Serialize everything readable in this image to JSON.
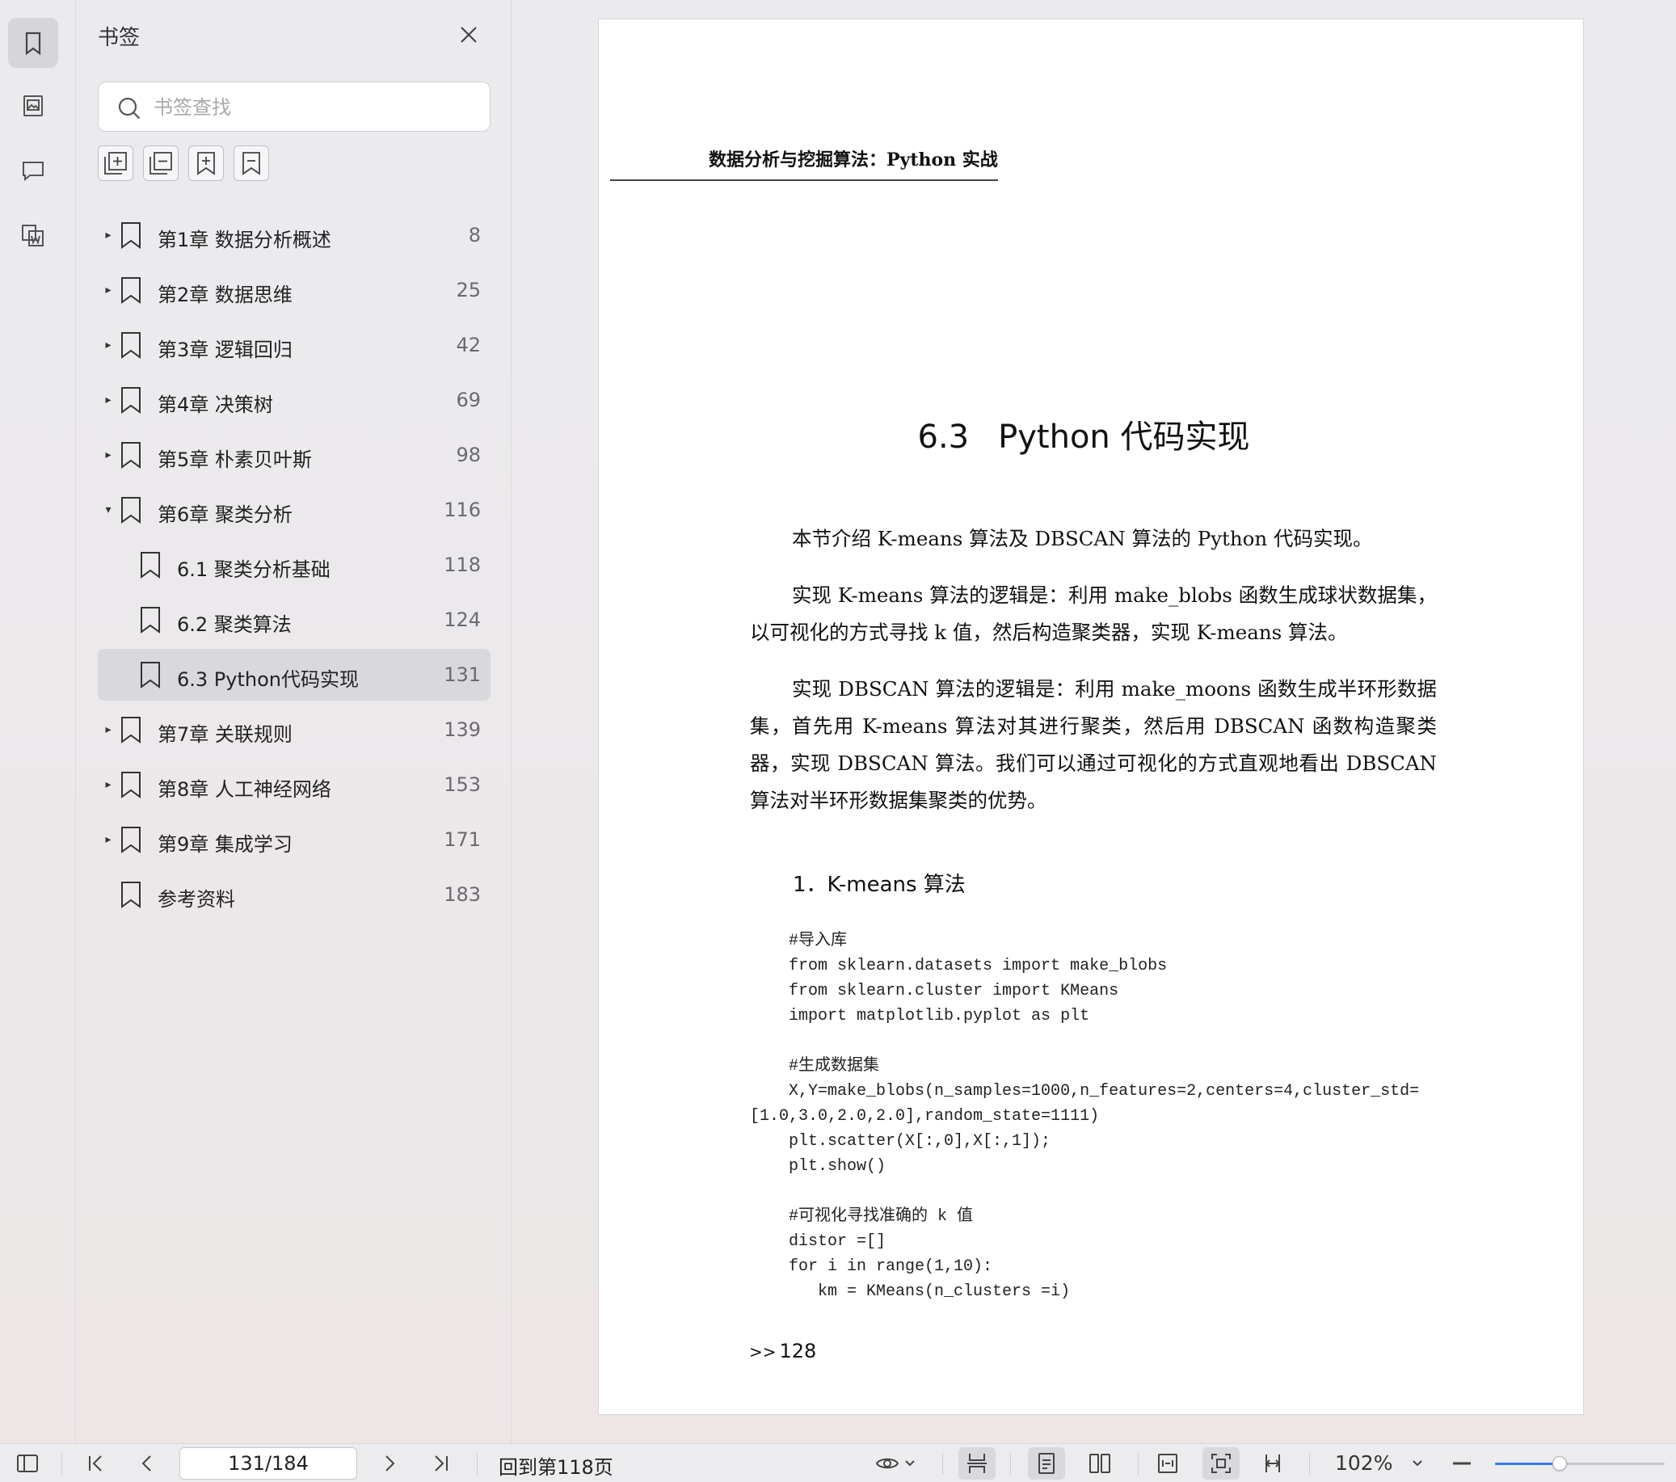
{
  "sidebar": {
    "title": "书签",
    "search_placeholder": "书签查找",
    "items": [
      {
        "label": "第1章 数据分析概述",
        "page": "8",
        "level": 0,
        "expand": "collapsed",
        "selected": false
      },
      {
        "label": "第2章 数据思维",
        "page": "25",
        "level": 0,
        "expand": "collapsed",
        "selected": false
      },
      {
        "label": "第3章 逻辑回归",
        "page": "42",
        "level": 0,
        "expand": "collapsed",
        "selected": false
      },
      {
        "label": "第4章 决策树",
        "page": "69",
        "level": 0,
        "expand": "collapsed",
        "selected": false
      },
      {
        "label": "第5章 朴素贝叶斯",
        "page": "98",
        "level": 0,
        "expand": "collapsed",
        "selected": false
      },
      {
        "label": "第6章 聚类分析",
        "page": "116",
        "level": 0,
        "expand": "expanded",
        "selected": false
      },
      {
        "label": "6.1 聚类分析基础",
        "page": "118",
        "level": 1,
        "expand": "none",
        "selected": false
      },
      {
        "label": "6.2 聚类算法",
        "page": "124",
        "level": 1,
        "expand": "none",
        "selected": false
      },
      {
        "label": "6.3 Python代码实现",
        "page": "131",
        "level": 1,
        "expand": "none",
        "selected": true
      },
      {
        "label": "第7章 关联规则",
        "page": "139",
        "level": 0,
        "expand": "collapsed",
        "selected": false
      },
      {
        "label": "第8章 人工神经网络",
        "page": "153",
        "level": 0,
        "expand": "collapsed",
        "selected": false
      },
      {
        "label": "第9章 集成学习",
        "page": "171",
        "level": 0,
        "expand": "collapsed",
        "selected": false
      },
      {
        "label": "参考资料",
        "page": "183",
        "level": 0,
        "expand": "none",
        "selected": false
      }
    ]
  },
  "document": {
    "running_head": "数据分析与挖掘算法：Python 实战",
    "section_number": "6.3",
    "section_title": "Python 代码实现",
    "paragraphs": [
      "本节介绍 K-means 算法及 DBSCAN 算法的 Python 代码实现。",
      "实现 K-means 算法的逻辑是：利用 make_blobs 函数生成球状数据集，以可视化的方式寻找 k 值，然后构造聚类器，实现 K-means 算法。",
      "实现 DBSCAN 算法的逻辑是：利用 make_moons 函数生成半环形数据集，首先用 K-means 算法对其进行聚类，然后用 DBSCAN 函数构造聚类器，实现 DBSCAN 算法。我们可以通过可视化的方式直观地看出 DBSCAN 算法对半环形数据集聚类的优势。"
    ],
    "subsection_title": "1．K-means 算法",
    "code": "    #导入库\n    from sklearn.datasets import make_blobs\n    from sklearn.cluster import KMeans\n    import matplotlib.pyplot as plt\n\n    #生成数据集\n    X,Y=make_blobs(n_samples=1000,n_features=2,centers=4,cluster_std=\n[1.0,3.0,2.0,2.0],random_state=1111)\n    plt.scatter(X[:,0],X[:,1]);\n    plt.show()\n\n    #可视化寻找准确的 k 值\n    distor =[]\n    for i in range(1,10):\n       km = KMeans(n_clusters =i)",
    "folio_prefix": ">>",
    "folio_number": "128"
  },
  "toolbar": {
    "page_indicator": "131/184",
    "goto_label": "回到第118页",
    "zoom": "102%",
    "zoom_level": 0.38,
    "accent": "#3a78f0"
  }
}
